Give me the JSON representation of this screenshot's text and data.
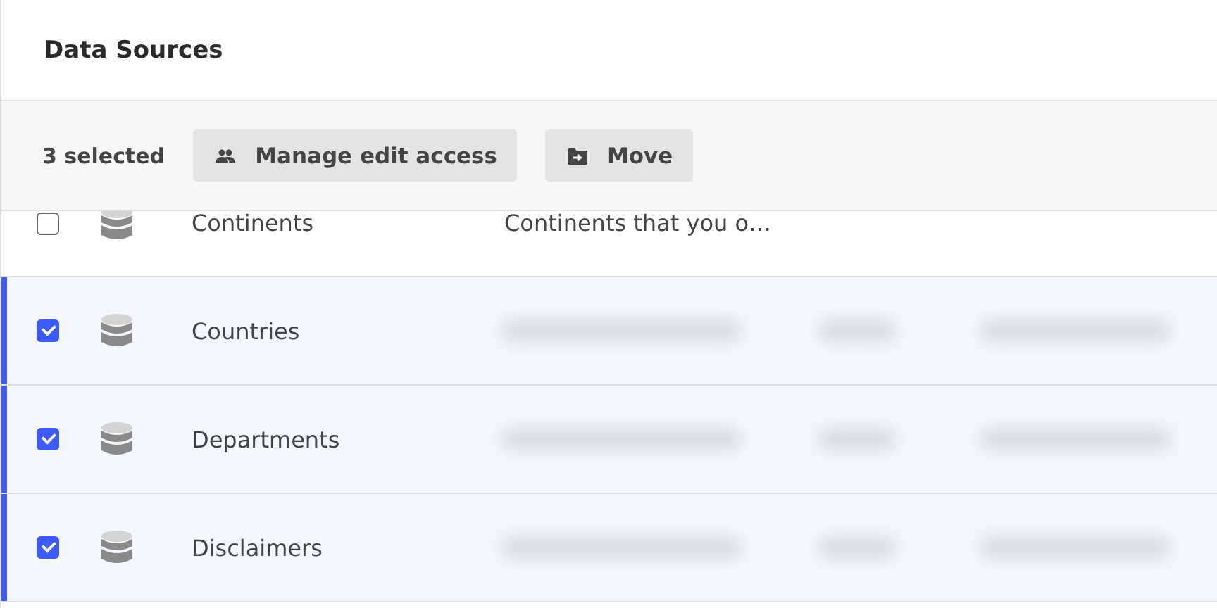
{
  "title": "Data Sources",
  "toolbar": {
    "count": "3 selected",
    "buttons": [
      {
        "kind": "people",
        "label": "Manage edit access"
      },
      {
        "kind": "move",
        "label": "Move"
      }
    ]
  },
  "rows": [
    {
      "name": "Continents",
      "description": "Continents that you o…",
      "checked": false,
      "redacted": false
    },
    {
      "name": "Countries",
      "checked": true,
      "redacted": true
    },
    {
      "name": "Departments",
      "checked": true,
      "redacted": true
    },
    {
      "name": "Disclaimers",
      "checked": true,
      "redacted": true
    }
  ]
}
